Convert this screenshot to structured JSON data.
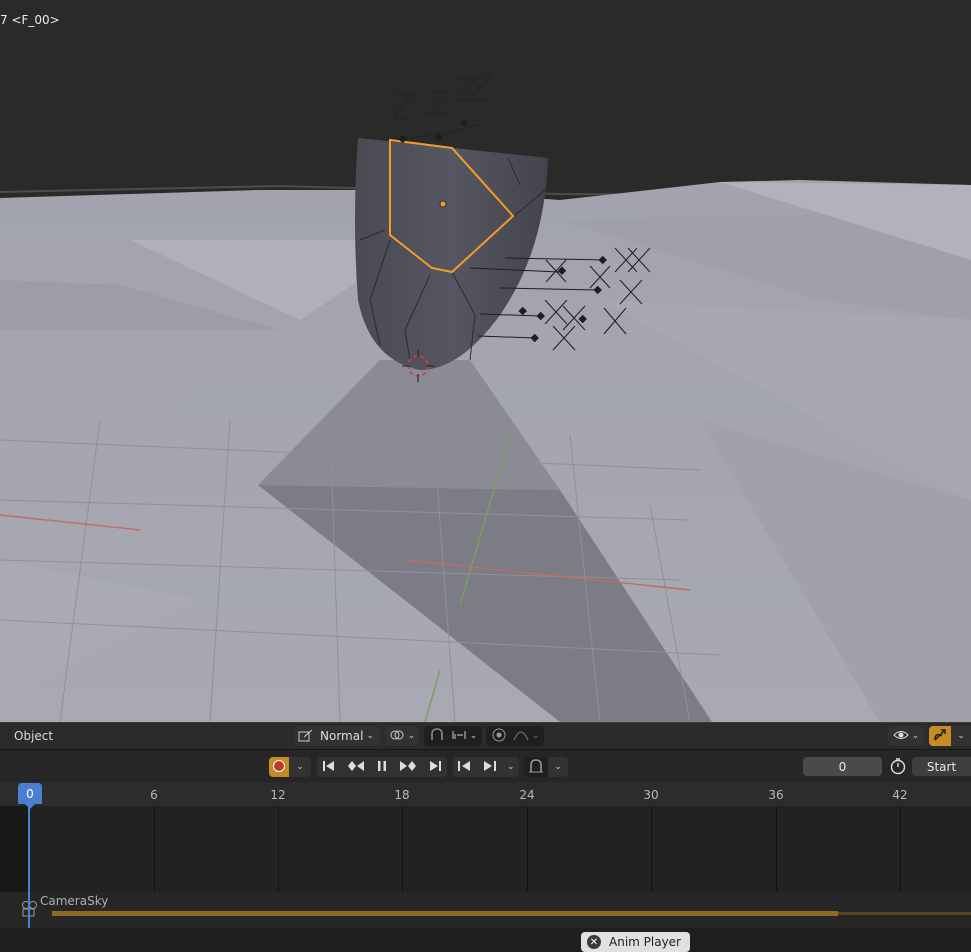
{
  "viewport": {
    "overlay_text": "7 <F_00>",
    "colors": {
      "selection": "#f59b2a",
      "ground": "#a9aab4",
      "sky": "#2a2a2a"
    }
  },
  "viewport_header": {
    "mode_label": "Object",
    "transform_orientation": "Normal",
    "icons": [
      "transform-orientation-icon",
      "pivot-point-icon",
      "snap-icon",
      "snap-target-icon",
      "proportional-edit-icon",
      "falloff-icon",
      "visibility-icon",
      "gizmo-icon"
    ]
  },
  "timeline_header": {
    "icons": [
      "record-icon",
      "jump-start-icon",
      "prev-keyframe-icon",
      "pause-icon",
      "next-keyframe-icon",
      "jump-end-icon",
      "prev-frame-icon",
      "next-frame-icon",
      "keying-icon",
      "auto-keying-icon",
      "timer-icon"
    ],
    "current_frame": "0",
    "start_label": "Start"
  },
  "timeline": {
    "playhead_frame": "0",
    "ruler_ticks": [
      "6",
      "12",
      "18",
      "24",
      "30",
      "36",
      "42"
    ],
    "scene_strip_label": "CameraSky",
    "colors": {
      "playhead": "#4a7fd0",
      "strip": "#8f6a25"
    }
  },
  "status_bar": {
    "anim_player_label": "Anim Player"
  }
}
